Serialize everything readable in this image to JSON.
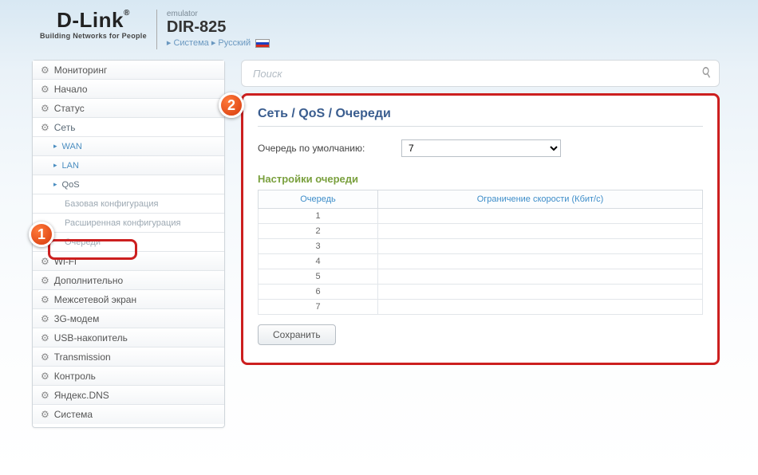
{
  "header": {
    "logo_main": "D-Link",
    "logo_sub": "Building Networks for People",
    "emulator": "emulator",
    "model": "DIR-825",
    "crumb1": "Система",
    "crumb2": "Русский"
  },
  "sidebar": {
    "items": [
      {
        "type": "top",
        "icon": "gear",
        "label": "Мониторинг"
      },
      {
        "type": "top",
        "icon": "gear",
        "label": "Начало"
      },
      {
        "type": "top",
        "icon": "gear",
        "label": "Статус"
      },
      {
        "type": "top",
        "icon": "gear",
        "label": "Сеть",
        "active": true
      },
      {
        "type": "sub1",
        "label": "WAN"
      },
      {
        "type": "sub1",
        "label": "LAN"
      },
      {
        "type": "sub1",
        "label": "QoS",
        "active": true
      },
      {
        "type": "sub2",
        "label": "Базовая конфигурация"
      },
      {
        "type": "sub2",
        "label": "Расширенная конфигурация"
      },
      {
        "type": "sub2",
        "label": "Очереди",
        "highlight": true
      },
      {
        "type": "top",
        "icon": "gear",
        "label": "Wi-Fi"
      },
      {
        "type": "top",
        "icon": "gear",
        "label": "Дополнительно"
      },
      {
        "type": "top",
        "icon": "gear",
        "label": "Межсетевой экран"
      },
      {
        "type": "top",
        "icon": "gear",
        "label": "3G-модем"
      },
      {
        "type": "top",
        "icon": "gear",
        "label": "USB-накопитель"
      },
      {
        "type": "top",
        "icon": "gear",
        "label": "Transmission"
      },
      {
        "type": "top",
        "icon": "gear",
        "label": "Контроль"
      },
      {
        "type": "top",
        "icon": "gear",
        "label": "Яндекс.DNS"
      },
      {
        "type": "top",
        "icon": "gear",
        "label": "Система"
      }
    ]
  },
  "search": {
    "placeholder": "Поиск"
  },
  "content": {
    "breadcrumb": "Сеть /  QoS /  Очереди",
    "default_queue_label": "Очередь по умолчанию:",
    "default_queue_value": "7",
    "section_title": "Настройки очереди",
    "table": {
      "col_queue": "Очередь",
      "col_limit": "Ограничение скорости (Кбит/с)",
      "rows": [
        {
          "queue": "1",
          "limit": ""
        },
        {
          "queue": "2",
          "limit": ""
        },
        {
          "queue": "3",
          "limit": ""
        },
        {
          "queue": "4",
          "limit": ""
        },
        {
          "queue": "5",
          "limit": ""
        },
        {
          "queue": "6",
          "limit": ""
        },
        {
          "queue": "7",
          "limit": ""
        }
      ]
    },
    "save_label": "Сохранить"
  },
  "badges": {
    "step1": "1",
    "step2": "2"
  }
}
